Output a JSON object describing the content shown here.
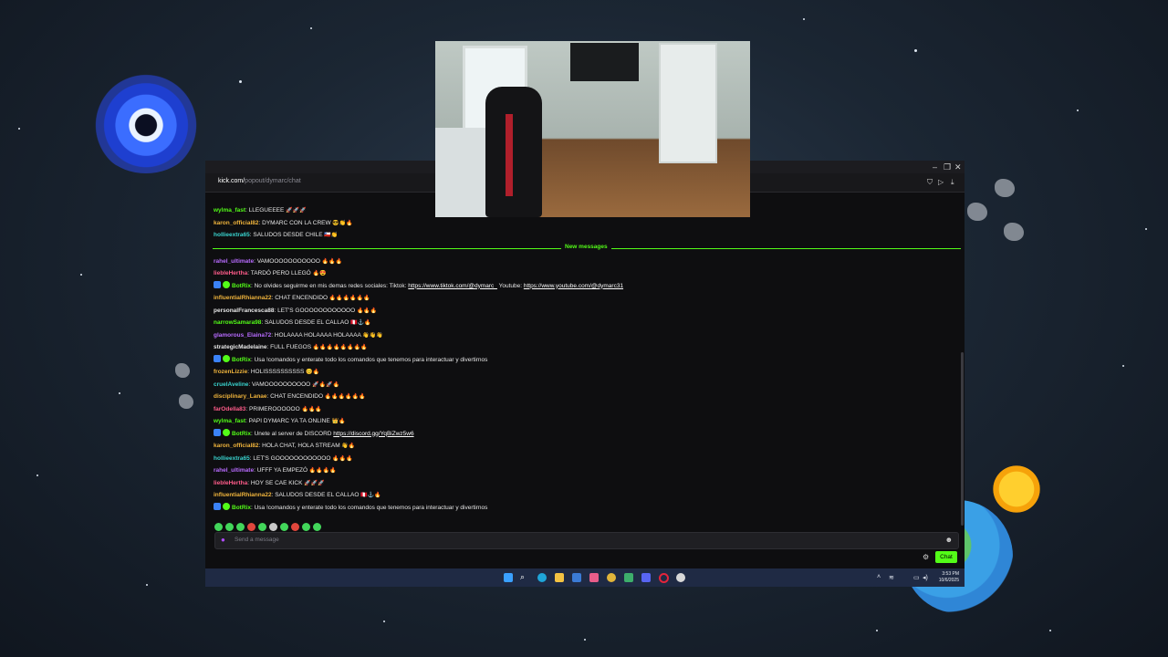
{
  "browser": {
    "url_domain": "kick.com/",
    "url_path": "popout/dymarc/chat"
  },
  "chat": {
    "messages_before": [
      {
        "user": "wylma_fast",
        "color": "#53fc18",
        "text": "LLEGUEEEE",
        "emotes": "🚀🚀🚀"
      },
      {
        "user": "karon_official82",
        "color": "#f0b43c",
        "text": "DYMARC CON LA CREW",
        "emotes": "😎👏🔥"
      },
      {
        "user": "hollieextra65",
        "color": "#39d3ce",
        "text": "SALUDOS DESDE CHILE",
        "emotes": "🇨🇱👏"
      }
    ],
    "separator_label": "New messages",
    "messages_after": [
      {
        "user": "rahel_ultimate",
        "color": "#b86bff",
        "text": "VAMOOOOOOOOOOO",
        "emotes": "🔥🔥🔥"
      },
      {
        "user": "liebleHertha",
        "color": "#ff5c8a",
        "text": "TARDÓ PERO LLEGÓ",
        "emotes": "🔥😍"
      },
      {
        "user": "BotRix",
        "color": "#53fc18",
        "bot": true,
        "text": "No olvides seguirme en mis demas redes sociales: Tiktok: ",
        "link1": "https://www.tiktok.com/@dymarc_",
        "mid": " Youtube: ",
        "link2": "https://www.youtube.com/@dymarc31"
      },
      {
        "user": "influentialRhianna22",
        "color": "#f0b43c",
        "text": "CHAT ENCENDIDO",
        "emotes": "🔥🔥🔥🔥🔥🔥"
      },
      {
        "user": "personalFrancesca88",
        "color": "#e6e6e6",
        "text": "LET'S GOOOOOOOOOOOO",
        "emotes": "🔥🔥🔥"
      },
      {
        "user": "narrowSamara98",
        "color": "#53fc18",
        "text": "SALUDOS DESDE EL CALLAO",
        "emotes": "🇵🇪⚓🔥"
      },
      {
        "user": "glamorous_Elaina72",
        "color": "#b86bff",
        "text": "HOLAAAA HOLAAAA HOLAAAA",
        "emotes": "👋👋👋"
      },
      {
        "user": "strategicMadelaine",
        "color": "#e6e6e6",
        "text": "FULL FUEGOS",
        "emotes": "🔥🔥🔥🔥🔥🔥🔥🔥"
      },
      {
        "user": "BotRix",
        "color": "#53fc18",
        "bot": true,
        "text": "Usa !comandos y enterate todo los comandos que tenemos para interactuar y divertirnos"
      },
      {
        "user": "frozenLizzie",
        "color": "#f0b43c",
        "text": "HOLISSSSSSSSSS",
        "emotes": "😊🔥"
      },
      {
        "user": "cruelAveline",
        "color": "#39d3ce",
        "text": "VAMOOOOOOOOOO",
        "emotes": "🚀🔥🚀🔥"
      },
      {
        "user": "disciplinary_Lanae",
        "color": "#f0b43c",
        "text": "CHAT ENCENDIDO",
        "emotes": "🔥🔥🔥🔥🔥🔥"
      },
      {
        "user": "farOdella83",
        "color": "#ff5c8a",
        "text": "PRIMEROOOOOO",
        "emotes": "🔥🔥🔥"
      },
      {
        "user": "wylma_fast",
        "color": "#53fc18",
        "text": "PAPI DYMARC YA TA ONLINE",
        "emotes": "👑🔥"
      },
      {
        "user": "BotRix",
        "color": "#53fc18",
        "bot": true,
        "text": "Unete al server de DISCORD ",
        "link1": "https://discord.gg/YqBiZwz5w6"
      },
      {
        "user": "karon_official82",
        "color": "#f0b43c",
        "text": "HOLA CHAT, HOLA STREAM",
        "emotes": "👋🔥"
      },
      {
        "user": "hollieextra65",
        "color": "#39d3ce",
        "text": "LET'S GOOOOOOOOOOOO",
        "emotes": "🔥🔥🔥"
      },
      {
        "user": "rahel_ultimate",
        "color": "#b86bff",
        "text": "UFFF YA EMPEZÓ",
        "emotes": "🔥🔥🔥🔥"
      },
      {
        "user": "liebleHertha",
        "color": "#ff5c8a",
        "text": "HOY SE CAE KICK",
        "emotes": "🚀🚀🚀"
      },
      {
        "user": "influentialRhianna22",
        "color": "#f0b43c",
        "text": "SALUDOS DESDE EL CALLAO",
        "emotes": "🇵🇪⚓🔥"
      },
      {
        "user": "BotRix",
        "color": "#53fc18",
        "bot": true,
        "text": "Usa !comandos y enterate todo los comandos que tenemos para interactuar y divertirnos"
      }
    ]
  },
  "input": {
    "placeholder": "Send a message",
    "send_label": "Chat"
  },
  "taskbar": {
    "time": "3:53 PM",
    "date": "10/6/2025"
  },
  "colors": {
    "accent": "#53fc18",
    "chat_bg": "#0e0e10",
    "taskbar_bg": "#1f2a44"
  }
}
